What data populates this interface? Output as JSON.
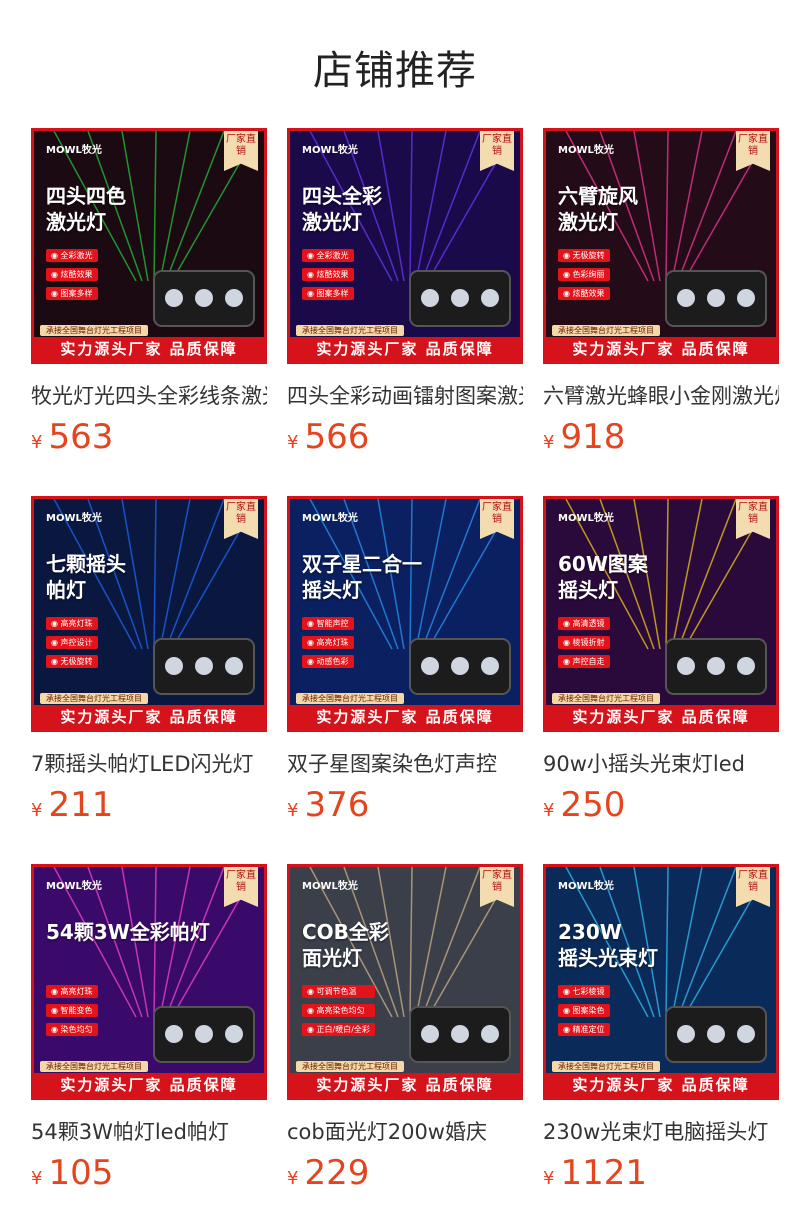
{
  "section_title": "店铺推荐",
  "common": {
    "brand": "MOWL牧光",
    "tag": "厂家直销",
    "band": "实力源头厂家 品质保障",
    "subband": "承接全国舞台灯光工程项目",
    "currency": "¥"
  },
  "products": [
    {
      "name": "牧光灯光四头全彩线条激光灯",
      "price": "563",
      "headline": "四头四色\n激光灯",
      "features": [
        "全彩激光",
        "炫酷效果",
        "图案多样"
      ],
      "bg": "#1b0a12",
      "accent": "#22d13a"
    },
    {
      "name": "四头全彩动画镭射图案激光灯",
      "price": "566",
      "headline": "四头全彩\n激光灯",
      "features": [
        "全彩激光",
        "炫酷效果",
        "图案多样"
      ],
      "bg": "#1a0a4a",
      "accent": "#6f3bff"
    },
    {
      "name": "六臂激光蜂眼小金刚激光灯",
      "price": "918",
      "headline": "六臂旋风\n激光灯",
      "features": [
        "无极旋转",
        "色彩绚丽",
        "炫酷效果"
      ],
      "bg": "#230c18",
      "accent": "#ff3aa0"
    },
    {
      "name": "7颗摇头帕灯LED闪光灯",
      "price": "211",
      "headline": "七颗摇头\n帕灯",
      "features": [
        "高亮灯珠",
        "声控设计",
        "无极旋转"
      ],
      "bg": "#0a1840",
      "accent": "#1e6bff"
    },
    {
      "name": "双子星图案染色灯声控",
      "price": "376",
      "headline": "双子星二合一\n摇头灯",
      "features": [
        "智能声控",
        "高亮灯珠",
        "动感色彩"
      ],
      "bg": "#0b2060",
      "accent": "#2a9cff"
    },
    {
      "name": "90w小摇头光束灯led",
      "price": "250",
      "headline": "60W图案\n摇头灯",
      "features": [
        "高清透镜",
        "棱镜折射",
        "声控自走"
      ],
      "bg": "#2a0a3a",
      "accent": "#ffd21a"
    },
    {
      "name": "54颗3W帕灯led帕灯",
      "price": "105",
      "headline": "54颗3W全彩帕灯",
      "features": [
        "高亮灯珠",
        "智能变色",
        "染色均匀"
      ],
      "bg": "#3a0a6a",
      "accent": "#ff4ad0"
    },
    {
      "name": "cob面光灯200w婚庆",
      "price": "229",
      "headline": "COB全彩\n面光灯",
      "features": [
        "可调节色温",
        "高亮染色均匀",
        "正白/暖白/全彩"
      ],
      "bg": "#3a3f4a",
      "accent": "#d8b88a"
    },
    {
      "name": "230w光束灯电脑摇头灯",
      "price": "1121",
      "headline": "230W\n摇头光束灯",
      "features": [
        "七彩棱镜",
        "图案染色",
        "精准定位"
      ],
      "bg": "#0a2a5a",
      "accent": "#36c8ff"
    }
  ]
}
